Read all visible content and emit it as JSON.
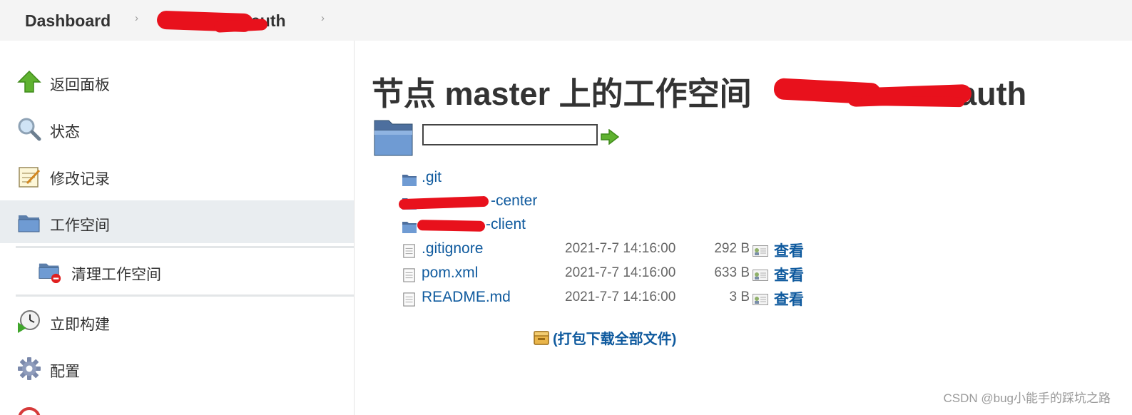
{
  "breadcrumb": {
    "items": [
      {
        "label": "Dashboard"
      },
      {
        "label": "auth"
      }
    ]
  },
  "sidebar": {
    "items": [
      {
        "label": "返回面板",
        "icon": "up-arrow-icon"
      },
      {
        "label": "状态",
        "icon": "magnifier-icon"
      },
      {
        "label": "修改记录",
        "icon": "notepad-icon"
      },
      {
        "label": "工作空间",
        "icon": "folder-icon"
      },
      {
        "label": "清理工作空间",
        "icon": "folder-delete-icon"
      },
      {
        "label": "立即构建",
        "icon": "clock-play-icon"
      },
      {
        "label": "配置",
        "icon": "gear-icon"
      }
    ]
  },
  "main": {
    "title_prefix": "节点 master 上的工作空间",
    "title_suffix": "-auth",
    "path_input_value": "",
    "files": [
      {
        "name": ".git",
        "type": "folder",
        "date": "",
        "size": "",
        "view": ""
      },
      {
        "name": "-center",
        "type": "folder",
        "date": "",
        "size": "",
        "view": ""
      },
      {
        "name": "-client",
        "type": "folder",
        "date": "",
        "size": "",
        "view": ""
      },
      {
        "name": ".gitignore",
        "type": "file",
        "date": "2021-7-7 14:16:00",
        "size": "292 B",
        "view": "查看"
      },
      {
        "name": "pom.xml",
        "type": "file",
        "date": "2021-7-7 14:16:00",
        "size": "633 B",
        "view": "查看"
      },
      {
        "name": "README.md",
        "type": "file",
        "date": "2021-7-7 14:16:00",
        "size": "3 B",
        "view": "查看"
      }
    ],
    "download_all": "(打包下载全部文件)"
  },
  "watermark": "CSDN @bug小能手的踩坑之路",
  "colors": {
    "link": "#0f5a9e",
    "redaction": "#e8111c",
    "sidebar_active": "#e9edf0"
  }
}
